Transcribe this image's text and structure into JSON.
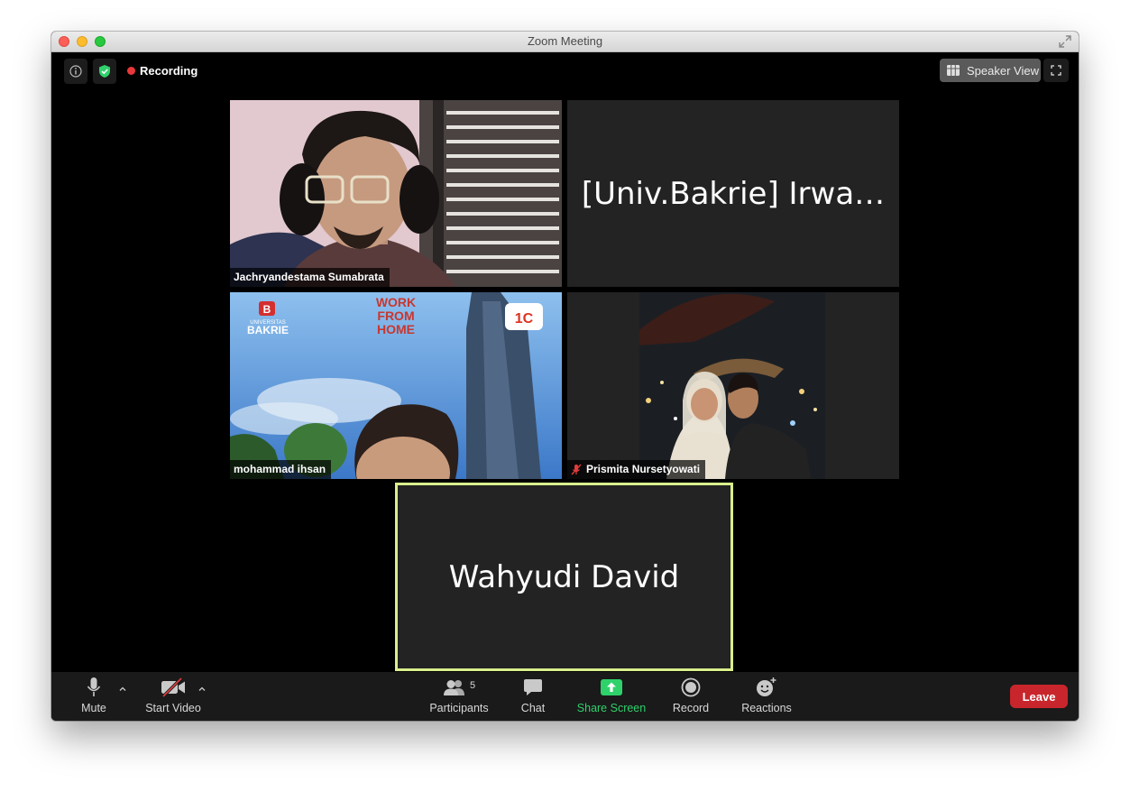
{
  "window": {
    "title": "Zoom Meeting"
  },
  "topbar": {
    "recording_label": "Recording",
    "speaker_view_label": "Speaker View"
  },
  "participants": [
    {
      "name": "Jachryandestama Sumabrata",
      "video": true
    },
    {
      "name": "[Univ.Bakrie] Irwa…",
      "video": false
    },
    {
      "name": "mohammad ihsan",
      "video": true
    },
    {
      "name": "Prismita Nursetyowati",
      "video": true,
      "muted": true
    },
    {
      "name": "Wahyudi David",
      "video": false,
      "active_speaker": true
    }
  ],
  "toolbar": {
    "mute_label": "Mute",
    "start_video_label": "Start Video",
    "participants_label": "Participants",
    "participants_count": "5",
    "chat_label": "Chat",
    "share_screen_label": "Share Screen",
    "record_label": "Record",
    "reactions_label": "Reactions",
    "leave_label": "Leave"
  },
  "colors": {
    "share_green": "#2fd16b",
    "leave_red": "#c8262c",
    "recording_red": "#e8373a",
    "active_speaker_border": "#d9ef8c"
  }
}
